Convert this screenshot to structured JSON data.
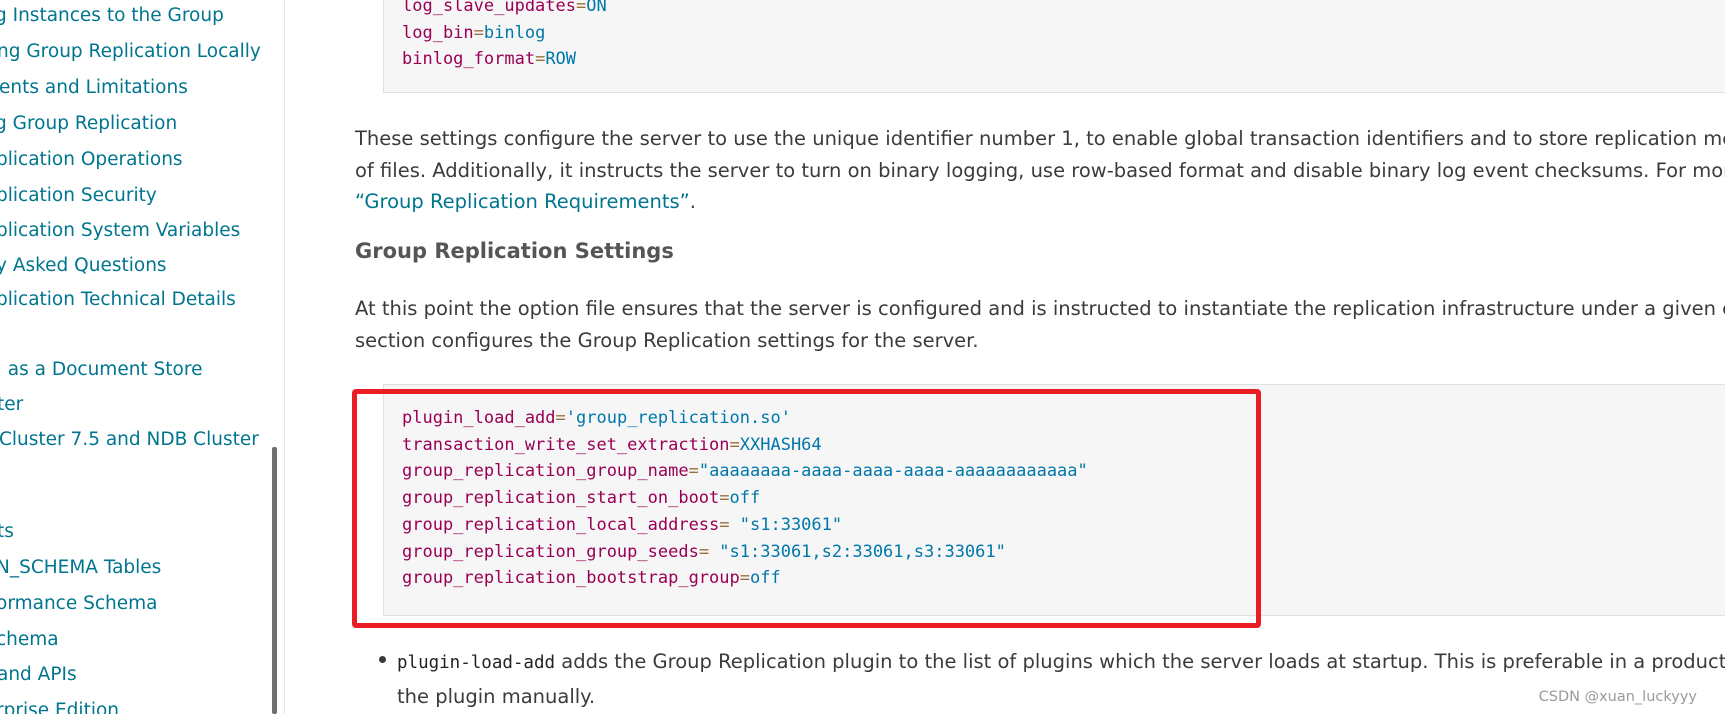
{
  "sidebar": {
    "links": [
      "g Instances to the Group",
      "ng Group Replication Locally",
      "ents and Limitations",
      "g Group Replication",
      "plication Operations",
      "plication Security",
      "plication System Variables",
      "y Asked Questions",
      "plication Technical Details",
      ". as a Document Store",
      "ter",
      "Cluster 7.5 and NDB Cluster",
      "ts",
      "N_SCHEMA Tables",
      "ormance Schema",
      "chema",
      "and APIs",
      "rprise Edition"
    ]
  },
  "code_top": {
    "lines": [
      {
        "key": "log_slave_updates",
        "op": "=",
        "val": "ON"
      },
      {
        "key": "log_bin",
        "op": "=",
        "val": "binlog"
      },
      {
        "key": "binlog_format",
        "op": "=",
        "val": "ROW"
      }
    ]
  },
  "para1": {
    "line1": "These settings configure the server to use the unique identifier number 1, to enable global transaction identifiers and to store replication metadata in",
    "line2": "of files. Additionally, it instructs the server to turn on binary logging, use row-based format and disable binary log event checksums. For more details",
    "link": "“Group Replication Requirements”",
    "tail": "."
  },
  "heading": "Group Replication Settings",
  "para2": {
    "line1": "At this point the option file ensures that the server is configured and is instructed to instantiate the replication infrastructure under a given configura",
    "line2": "section configures the Group Replication settings for the server."
  },
  "code_main": {
    "lines": [
      {
        "key": "plugin_load_add",
        "op": "=",
        "val": "'group_replication.so'"
      },
      {
        "key": "transaction_write_set_extraction",
        "op": "=",
        "val": "XXHASH64"
      },
      {
        "key": "group_replication_group_name",
        "op": "=",
        "val": "\"aaaaaaaa-aaaa-aaaa-aaaa-aaaaaaaaaaaa\""
      },
      {
        "key": "group_replication_start_on_boot",
        "op": "=",
        "val": "off"
      },
      {
        "key": "group_replication_local_address",
        "op": "= ",
        "val": "\"s1:33061\""
      },
      {
        "key": "group_replication_group_seeds",
        "op": "= ",
        "val": "\"s1:33061,s2:33061,s3:33061\""
      },
      {
        "key": "group_replication_bootstrap_group",
        "op": "=",
        "val": "off"
      }
    ]
  },
  "bullet": {
    "code": "plugin-load-add",
    "text": " adds the Group Replication plugin to the list of plugins which the server loads at startup. This is preferable in a production de",
    "line2": "the plugin manually."
  },
  "watermark": "CSDN @xuan_luckyyy",
  "colors": {
    "link": "#00758f",
    "highlight": "#ea1c24",
    "code_key": "#990055",
    "code_val": "#0077aa"
  }
}
